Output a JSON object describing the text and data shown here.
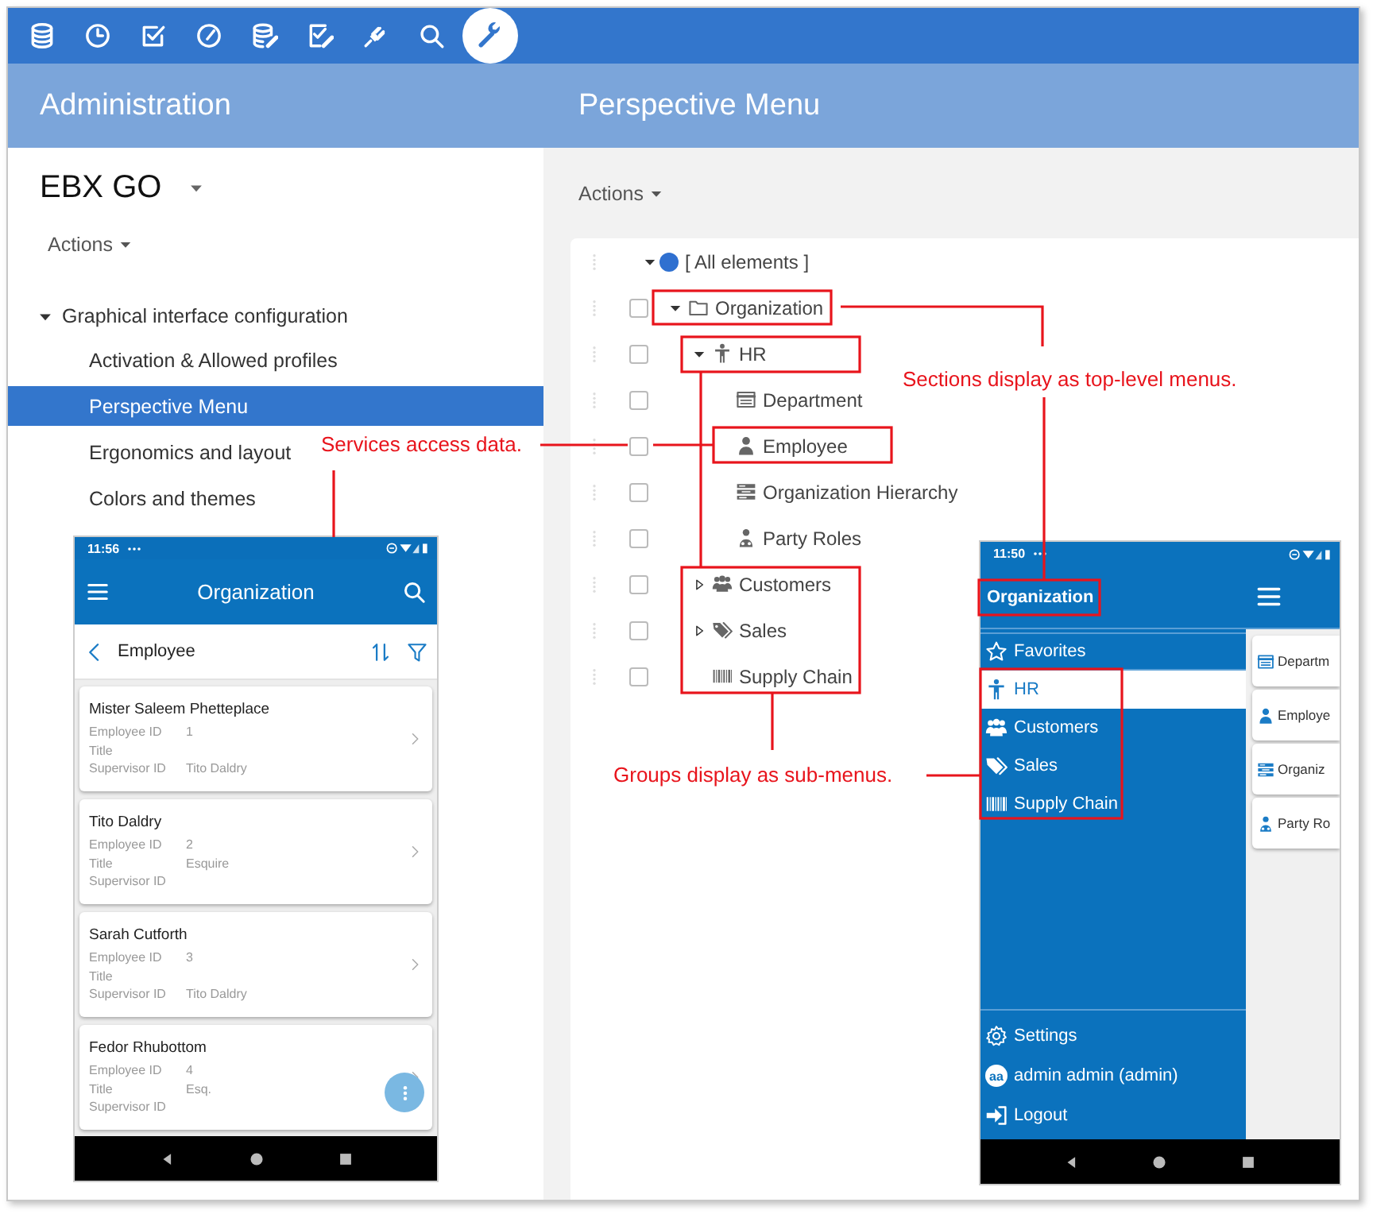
{
  "toolbar": {
    "buttons": [
      {
        "selected": false
      },
      {
        "selected": false
      },
      {
        "selected": false
      },
      {
        "selected": false
      },
      {
        "selected": false
      },
      {
        "selected": false
      },
      {
        "selected": false
      },
      {
        "selected": false
      },
      {
        "selected": true
      }
    ]
  },
  "header": {
    "left_title": "Administration",
    "right_title": "Perspective Menu"
  },
  "sidebar": {
    "title": "EBX GO",
    "actions": "Actions",
    "group": {
      "label": "Graphical interface configuration",
      "expanded": true,
      "items": [
        {
          "label": "Activation & Allowed profiles",
          "selected": false
        },
        {
          "label": "Perspective Menu",
          "selected": true
        },
        {
          "label": "Ergonomics and layout",
          "selected": false
        },
        {
          "label": "Colors and themes",
          "selected": false
        }
      ]
    }
  },
  "main": {
    "actions": "Actions",
    "tree": {
      "label": "[ All elements ]",
      "expanded": true,
      "children": [
        {
          "label": "Organization",
          "kind": "section",
          "checked": false,
          "expanded": true,
          "children": [
            {
              "label": "HR",
              "kind": "group",
              "checked": false,
              "expanded": true,
              "children": [
                {
                  "label": "Department",
                  "kind": "table",
                  "checked": false
                },
                {
                  "label": "Employee",
                  "kind": "table",
                  "checked": false
                },
                {
                  "label": "Organization Hierarchy",
                  "kind": "table",
                  "checked": false
                },
                {
                  "label": "Party Roles",
                  "kind": "table",
                  "checked": false
                }
              ]
            },
            {
              "label": "Customers",
              "kind": "group",
              "checked": false,
              "expanded": false
            },
            {
              "label": "Sales",
              "kind": "group",
              "checked": false,
              "expanded": false
            },
            {
              "label": "Supply Chain",
              "kind": "group",
              "checked": false
            }
          ]
        }
      ]
    }
  },
  "annotations": [
    {
      "text": "Services access data."
    },
    {
      "text": "Sections display as top-level menus."
    },
    {
      "text": "Groups display as sub-menus."
    }
  ],
  "phone_list": {
    "time": "11:56",
    "title": "Organization",
    "subtitle": "Employee",
    "cards": [
      {
        "name": "Mister Saleem Phetteplace",
        "fields": [
          {
            "label": "Employee ID",
            "value": "1"
          },
          {
            "label": "Title"
          },
          {
            "label": "Supervisor ID",
            "value": "Tito Daldry"
          }
        ]
      },
      {
        "name": "Tito Daldry",
        "fields": [
          {
            "label": "Employee ID",
            "value": "2"
          },
          {
            "label": "Title",
            "value": "Esquire"
          },
          {
            "label": "Supervisor ID"
          }
        ]
      },
      {
        "name": "Sarah Cutforth",
        "fields": [
          {
            "label": "Employee ID",
            "value": "3"
          },
          {
            "label": "Title"
          },
          {
            "label": "Supervisor ID",
            "value": "Tito Daldry"
          }
        ]
      },
      {
        "name": "Fedor Rhubottom",
        "fields": [
          {
            "label": "Employee ID",
            "value": "4"
          },
          {
            "label": "Title",
            "value": "Esq."
          },
          {
            "label": "Supervisor ID"
          }
        ]
      }
    ]
  },
  "phone_menu": {
    "time": "11:50",
    "title": "Organization",
    "items": [
      {
        "label": "Favorites",
        "selected": false
      },
      {
        "label": "HR",
        "selected": true
      },
      {
        "label": "Customers",
        "selected": false
      },
      {
        "label": "Sales",
        "selected": false
      },
      {
        "label": "Supply Chain",
        "selected": false
      }
    ],
    "footer": [
      {
        "label": "Settings"
      },
      {
        "avatar": "aa",
        "label": "admin admin (admin)"
      },
      {
        "label": "Logout"
      }
    ],
    "cards": [
      "Departm",
      "Employe",
      "Organiz",
      "Party Ro"
    ]
  }
}
